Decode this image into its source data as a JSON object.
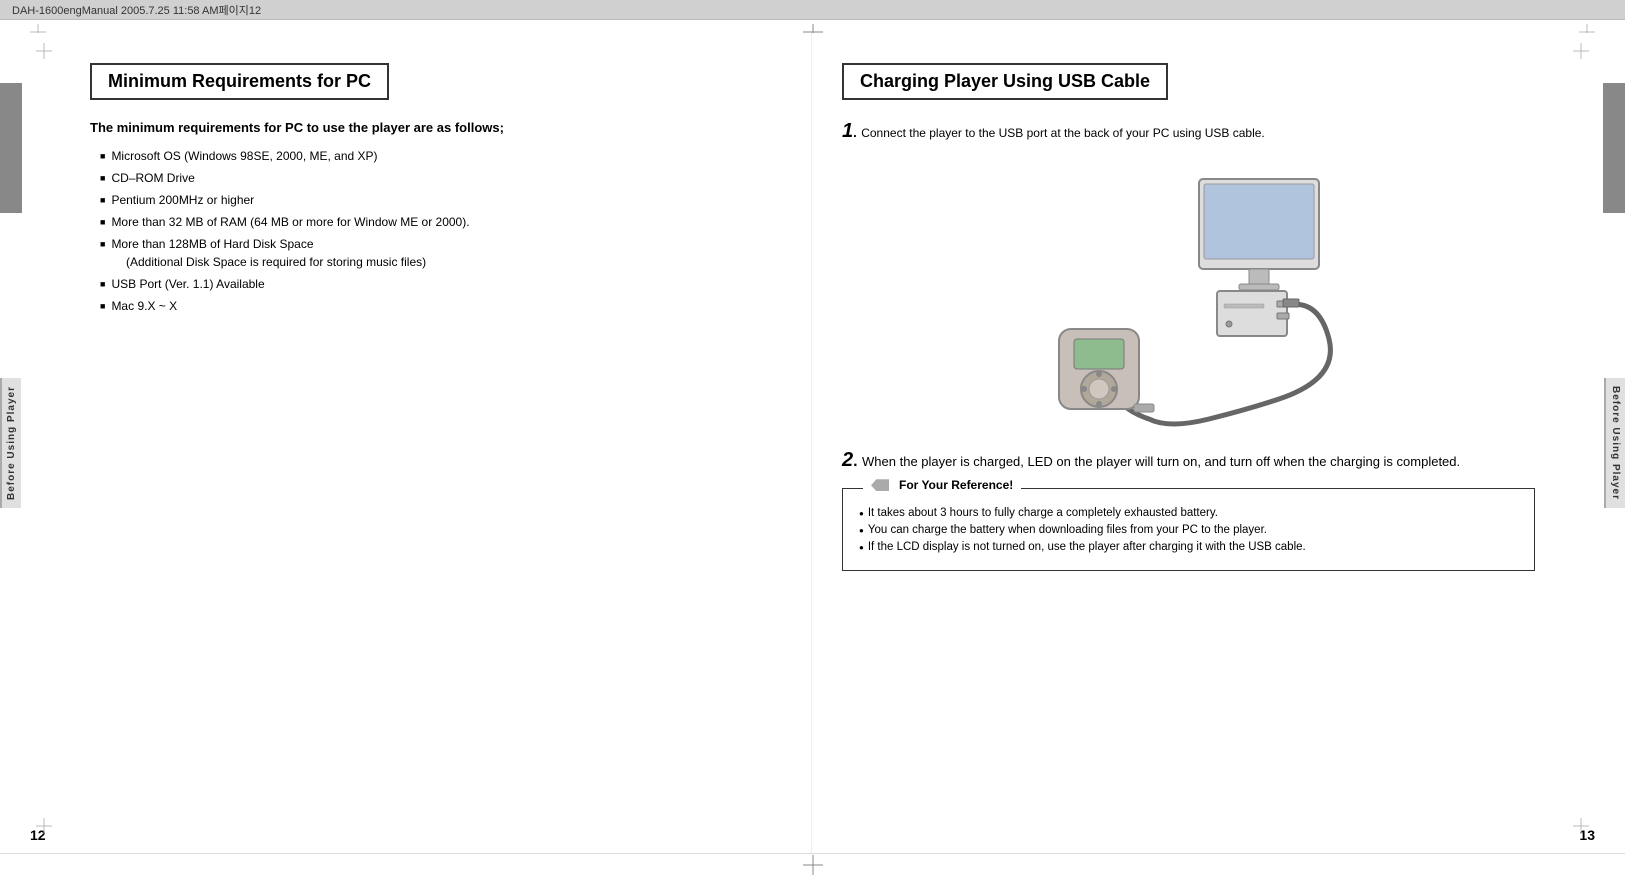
{
  "header": {
    "text": "DAH-1600engManual  2005.7.25 11:58 AM페이지12"
  },
  "left_page": {
    "section_title": "Minimum Requirements for PC",
    "intro": "The minimum requirements for PC to use the player are as follows;",
    "requirements": [
      "Microsoft OS (Windows 98SE, 2000, ME, and XP)",
      "CD–ROM Drive",
      "Pentium 200MHz or higher",
      "More than 32 MB of RAM (64 MB or more for Window ME or 2000).",
      "More than 128MB of Hard Disk Space",
      "(Additional Disk Space is required for storing music files)",
      "USB Port (Ver. 1.1) Available",
      "Mac 9.X ~ X"
    ],
    "side_tab": "Before Using Player",
    "page_number": "12"
  },
  "right_page": {
    "section_title": "Charging Player Using USB Cable",
    "step1_number": "1",
    "step1_text": "Connect the player to the USB port at the back of your PC using USB cable.",
    "step2_number": "2",
    "step2_text": "When the player is charged, LED on the player will turn on, and turn off when the charging is completed.",
    "reference": {
      "title": "For Your Reference!",
      "items": [
        "It takes about 3 hours to fully charge a completely exhausted battery.",
        "You can charge the battery when downloading files from your PC to the player.",
        "If  the LCD display is not turned on, use the player after charging it with the USB cable."
      ]
    },
    "side_tab": "Before Using Player",
    "page_number": "13"
  }
}
